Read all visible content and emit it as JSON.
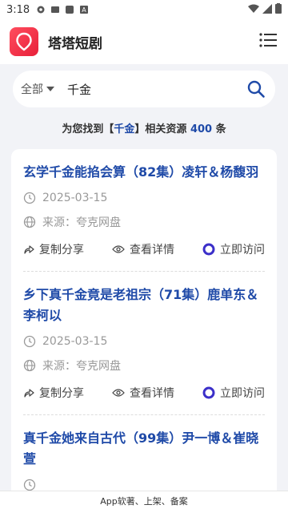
{
  "status_bar": {
    "time": "3:18"
  },
  "header": {
    "app_title": "塔塔短剧"
  },
  "search": {
    "scope": "全部",
    "query": "千金"
  },
  "summary": {
    "prefix": "为您找到【",
    "keyword": "千金",
    "middle": "】相关资源 ",
    "count": "400",
    "suffix": " 条"
  },
  "results": [
    {
      "title": "玄学千金能掐会算（82集）凌轩＆杨馥羽",
      "date": "2025-03-15",
      "source": "来源：夸克网盘",
      "share_label": "复制分享",
      "detail_label": "查看详情",
      "visit_label": "立即访问"
    },
    {
      "title": "乡下真千金竟是老祖宗（71集）鹿单东＆李柯以",
      "date": "2025-03-15",
      "source": "来源：夸克网盘",
      "share_label": "复制分享",
      "detail_label": "查看详情",
      "visit_label": "立即访问"
    },
    {
      "title": "真千金她来自古代（99集）尹一博＆崔晓萱",
      "date": "",
      "source": "",
      "share_label": "",
      "detail_label": "",
      "visit_label": ""
    }
  ],
  "bottom_bar": {
    "text": "App软著、上架、备案"
  },
  "colors": {
    "accent": "#1f4aa8",
    "brand": "#e8203a",
    "visit": "#3b2fc9"
  }
}
